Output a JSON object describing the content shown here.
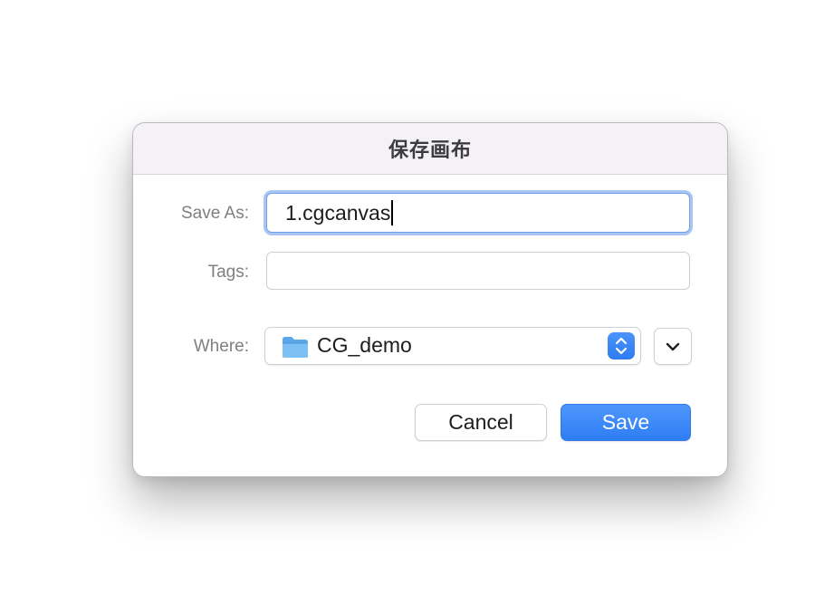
{
  "dialog": {
    "title": "保存画布"
  },
  "save_as": {
    "label": "Save As:",
    "value": "1.cgcanvas"
  },
  "tags": {
    "label": "Tags:",
    "value": ""
  },
  "where": {
    "label": "Where:",
    "selected": "CG_demo",
    "icon": "folder-icon"
  },
  "buttons": {
    "cancel_label": "Cancel",
    "save_label": "Save"
  },
  "colors": {
    "accent": "#3380f6",
    "focus_ring": "#a9c6f3",
    "titlebar_bg": "#f4f2f6"
  }
}
